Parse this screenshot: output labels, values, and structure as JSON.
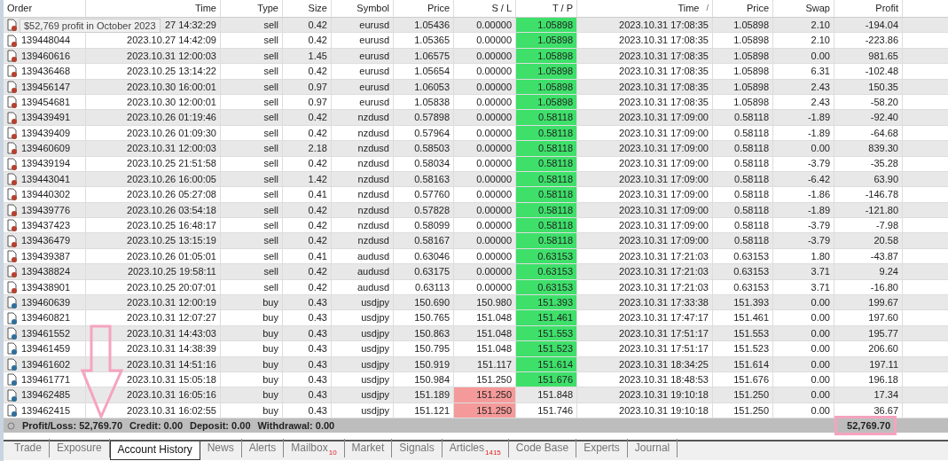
{
  "tooltip": "$52,769 profit in October 2023",
  "columns": [
    {
      "label": "Order"
    },
    {
      "label": "Time"
    },
    {
      "label": "Type"
    },
    {
      "label": "Size"
    },
    {
      "label": "Symbol"
    },
    {
      "label": "Price"
    },
    {
      "label": "S / L"
    },
    {
      "label": "T / P"
    },
    {
      "label": "Time",
      "sort_mark": "/"
    },
    {
      "label": "Price"
    },
    {
      "label": "Swap"
    },
    {
      "label": "Profit"
    }
  ],
  "rows": [
    {
      "kind": "sell",
      "cells": [
        "",
        "27 14:32:29",
        "sell",
        "0.42",
        "eurusd",
        "1.05436",
        "0.00000",
        "1.05898",
        "2023.10.31 17:08:35",
        "1.05898",
        "2.10",
        "-194.04"
      ],
      "sl_hit": false,
      "tp_hit": true
    },
    {
      "kind": "sell",
      "cells": [
        "139448044",
        "2023.10.27 14:42:09",
        "sell",
        "0.42",
        "eurusd",
        "1.05365",
        "0.00000",
        "1.05898",
        "2023.10.31 17:08:35",
        "1.05898",
        "2.10",
        "-223.86"
      ],
      "sl_hit": false,
      "tp_hit": true
    },
    {
      "kind": "sell",
      "cells": [
        "139460616",
        "2023.10.31 12:00:03",
        "sell",
        "1.45",
        "eurusd",
        "1.06575",
        "0.00000",
        "1.05898",
        "2023.10.31 17:08:35",
        "1.05898",
        "0.00",
        "981.65"
      ],
      "sl_hit": false,
      "tp_hit": true
    },
    {
      "kind": "sell",
      "cells": [
        "139436468",
        "2023.10.25 13:14:22",
        "sell",
        "0.42",
        "eurusd",
        "1.05654",
        "0.00000",
        "1.05898",
        "2023.10.31 17:08:35",
        "1.05898",
        "6.31",
        "-102.48"
      ],
      "sl_hit": false,
      "tp_hit": true
    },
    {
      "kind": "sell",
      "cells": [
        "139456147",
        "2023.10.30 16:00:01",
        "sell",
        "0.97",
        "eurusd",
        "1.06053",
        "0.00000",
        "1.05898",
        "2023.10.31 17:08:35",
        "1.05898",
        "2.43",
        "150.35"
      ],
      "sl_hit": false,
      "tp_hit": true
    },
    {
      "kind": "sell",
      "cells": [
        "139454681",
        "2023.10.30 12:00:01",
        "sell",
        "0.97",
        "eurusd",
        "1.05838",
        "0.00000",
        "1.05898",
        "2023.10.31 17:08:35",
        "1.05898",
        "2.43",
        "-58.20"
      ],
      "sl_hit": false,
      "tp_hit": true
    },
    {
      "kind": "sell",
      "cells": [
        "139439491",
        "2023.10.26 01:19:46",
        "sell",
        "0.42",
        "nzdusd",
        "0.57898",
        "0.00000",
        "0.58118",
        "2023.10.31 17:09:00",
        "0.58118",
        "-1.89",
        "-92.40"
      ],
      "sl_hit": false,
      "tp_hit": true
    },
    {
      "kind": "sell",
      "cells": [
        "139439409",
        "2023.10.26 01:09:30",
        "sell",
        "0.42",
        "nzdusd",
        "0.57964",
        "0.00000",
        "0.58118",
        "2023.10.31 17:09:00",
        "0.58118",
        "-1.89",
        "-64.68"
      ],
      "sl_hit": false,
      "tp_hit": true
    },
    {
      "kind": "sell",
      "cells": [
        "139460609",
        "2023.10.31 12:00:03",
        "sell",
        "2.18",
        "nzdusd",
        "0.58503",
        "0.00000",
        "0.58118",
        "2023.10.31 17:09:00",
        "0.58118",
        "0.00",
        "839.30"
      ],
      "sl_hit": false,
      "tp_hit": true
    },
    {
      "kind": "sell",
      "cells": [
        "139439194",
        "2023.10.25 21:51:58",
        "sell",
        "0.42",
        "nzdusd",
        "0.58034",
        "0.00000",
        "0.58118",
        "2023.10.31 17:09:00",
        "0.58118",
        "-3.79",
        "-35.28"
      ],
      "sl_hit": false,
      "tp_hit": true
    },
    {
      "kind": "sell",
      "cells": [
        "139443041",
        "2023.10.26 16:00:05",
        "sell",
        "1.42",
        "nzdusd",
        "0.58163",
        "0.00000",
        "0.58118",
        "2023.10.31 17:09:00",
        "0.58118",
        "-6.42",
        "63.90"
      ],
      "sl_hit": false,
      "tp_hit": true
    },
    {
      "kind": "sell",
      "cells": [
        "139440302",
        "2023.10.26 05:27:08",
        "sell",
        "0.41",
        "nzdusd",
        "0.57760",
        "0.00000",
        "0.58118",
        "2023.10.31 17:09:00",
        "0.58118",
        "-1.86",
        "-146.78"
      ],
      "sl_hit": false,
      "tp_hit": true
    },
    {
      "kind": "sell",
      "cells": [
        "139439776",
        "2023.10.26 03:54:18",
        "sell",
        "0.42",
        "nzdusd",
        "0.57828",
        "0.00000",
        "0.58118",
        "2023.10.31 17:09:00",
        "0.58118",
        "-1.89",
        "-121.80"
      ],
      "sl_hit": false,
      "tp_hit": true
    },
    {
      "kind": "sell",
      "cells": [
        "139437423",
        "2023.10.25 16:48:17",
        "sell",
        "0.42",
        "nzdusd",
        "0.58099",
        "0.00000",
        "0.58118",
        "2023.10.31 17:09:00",
        "0.58118",
        "-3.79",
        "-7.98"
      ],
      "sl_hit": false,
      "tp_hit": true
    },
    {
      "kind": "sell",
      "cells": [
        "139436479",
        "2023.10.25 13:15:19",
        "sell",
        "0.42",
        "nzdusd",
        "0.58167",
        "0.00000",
        "0.58118",
        "2023.10.31 17:09:00",
        "0.58118",
        "-3.79",
        "20.58"
      ],
      "sl_hit": false,
      "tp_hit": true
    },
    {
      "kind": "sell",
      "cells": [
        "139439387",
        "2023.10.26 01:05:01",
        "sell",
        "0.41",
        "audusd",
        "0.63046",
        "0.00000",
        "0.63153",
        "2023.10.31 17:21:03",
        "0.63153",
        "1.80",
        "-43.87"
      ],
      "sl_hit": false,
      "tp_hit": true
    },
    {
      "kind": "sell",
      "cells": [
        "139438824",
        "2023.10.25 19:58:11",
        "sell",
        "0.42",
        "audusd",
        "0.63175",
        "0.00000",
        "0.63153",
        "2023.10.31 17:21:03",
        "0.63153",
        "3.71",
        "9.24"
      ],
      "sl_hit": false,
      "tp_hit": true
    },
    {
      "kind": "sell",
      "cells": [
        "139438901",
        "2023.10.25 20:07:01",
        "sell",
        "0.42",
        "audusd",
        "0.63113",
        "0.00000",
        "0.63153",
        "2023.10.31 17:21:03",
        "0.63153",
        "3.71",
        "-16.80"
      ],
      "sl_hit": false,
      "tp_hit": true
    },
    {
      "kind": "buy",
      "cells": [
        "139460639",
        "2023.10.31 12:00:19",
        "buy",
        "0.43",
        "usdjpy",
        "150.690",
        "150.980",
        "151.393",
        "2023.10.31 17:33:38",
        "151.393",
        "0.00",
        "199.67"
      ],
      "sl_hit": false,
      "tp_hit": true
    },
    {
      "kind": "buy",
      "cells": [
        "139460821",
        "2023.10.31 12:07:27",
        "buy",
        "0.43",
        "usdjpy",
        "150.765",
        "151.048",
        "151.461",
        "2023.10.31 17:47:17",
        "151.461",
        "0.00",
        "197.60"
      ],
      "sl_hit": false,
      "tp_hit": true
    },
    {
      "kind": "buy",
      "cells": [
        "139461552",
        "2023.10.31 14:43:03",
        "buy",
        "0.43",
        "usdjpy",
        "150.863",
        "151.048",
        "151.553",
        "2023.10.31 17:51:17",
        "151.553",
        "0.00",
        "195.77"
      ],
      "sl_hit": false,
      "tp_hit": true
    },
    {
      "kind": "buy",
      "cells": [
        "139461459",
        "2023.10.31 14:38:39",
        "buy",
        "0.43",
        "usdjpy",
        "150.795",
        "151.048",
        "151.523",
        "2023.10.31 17:51:17",
        "151.523",
        "0.00",
        "206.60"
      ],
      "sl_hit": false,
      "tp_hit": true
    },
    {
      "kind": "buy",
      "cells": [
        "139461602",
        "2023.10.31 14:51:16",
        "buy",
        "0.43",
        "usdjpy",
        "150.919",
        "151.117",
        "151.614",
        "2023.10.31 18:34:25",
        "151.614",
        "0.00",
        "197.11"
      ],
      "sl_hit": false,
      "tp_hit": true
    },
    {
      "kind": "buy",
      "cells": [
        "139461771",
        "2023.10.31 15:05:18",
        "buy",
        "0.43",
        "usdjpy",
        "150.984",
        "151.250",
        "151.676",
        "2023.10.31 18:48:53",
        "151.676",
        "0.00",
        "196.18"
      ],
      "sl_hit": false,
      "tp_hit": true
    },
    {
      "kind": "buy",
      "cells": [
        "139462485",
        "2023.10.31 16:05:16",
        "buy",
        "0.43",
        "usdjpy",
        "151.189",
        "151.250",
        "151.848",
        "2023.10.31 19:10:18",
        "151.250",
        "0.00",
        "17.34"
      ],
      "sl_hit": true,
      "tp_hit": false
    },
    {
      "kind": "buy",
      "cells": [
        "139462415",
        "2023.10.31 16:02:55",
        "buy",
        "0.43",
        "usdjpy",
        "151.121",
        "151.250",
        "151.746",
        "2023.10.31 19:10:18",
        "151.250",
        "0.00",
        "36.67"
      ],
      "sl_hit": true,
      "tp_hit": false
    }
  ],
  "summary": {
    "items": [
      "Profit/Loss: 52,769.70",
      "Credit: 0.00",
      "Deposit: 0.00",
      "Withdrawal: 0.00"
    ],
    "total": "52,769.70"
  },
  "tabs": [
    {
      "label": "Trade",
      "selected": false
    },
    {
      "label": "Exposure",
      "selected": false
    },
    {
      "label": "Account History",
      "selected": true
    },
    {
      "label": "News",
      "selected": false
    },
    {
      "label": "Alerts",
      "selected": false
    },
    {
      "label": "Mailbox",
      "badge": "10",
      "selected": false
    },
    {
      "label": "Market",
      "selected": false
    },
    {
      "label": "Signals",
      "selected": false
    },
    {
      "label": "Articles",
      "badge": "1415",
      "selected": false
    },
    {
      "label": "Code Base",
      "selected": false
    },
    {
      "label": "Experts",
      "selected": false
    },
    {
      "label": "Journal",
      "selected": false
    }
  ]
}
